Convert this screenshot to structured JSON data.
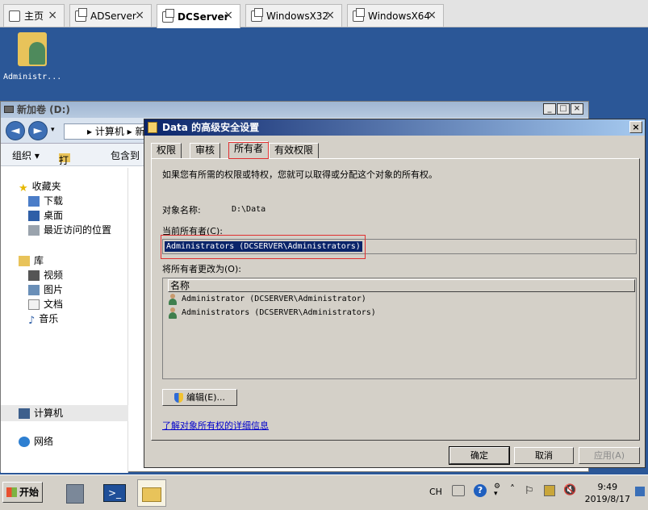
{
  "tabs": [
    {
      "label": "主页",
      "icon": "home-icon"
    },
    {
      "label": "ADServer",
      "icon": "window-icon"
    },
    {
      "label": "DCServer",
      "icon": "window-icon",
      "active": true
    },
    {
      "label": "WindowsX32",
      "icon": "window-icon"
    },
    {
      "label": "WindowsX64",
      "icon": "window-icon"
    }
  ],
  "desktop": {
    "icon_label": "Administr..."
  },
  "explorer": {
    "title": "新加卷 (D:)",
    "controls": {
      "minimize": "_",
      "maximize": "□",
      "close": "×"
    },
    "address": "▸ 计算机 ▸ 新",
    "toolbar": {
      "organize": "组织 ▾",
      "open": "打开",
      "include": "包含到"
    },
    "sidebar": {
      "favorites": "收藏夹",
      "downloads": "下载",
      "desktop": "桌面",
      "recent": "最近访问的位置",
      "libraries": "库",
      "videos": "视频",
      "pictures": "图片",
      "documents": "文档",
      "music": "音乐",
      "computer": "计算机",
      "network": "网络"
    }
  },
  "dialog": {
    "title": "Data 的高级安全设置",
    "close": "×",
    "tabs": [
      "权限",
      "审核",
      "所有者",
      "有效权限"
    ],
    "info": "如果您有所需的权限或特权，您就可以取得或分配这个对象的所有权。",
    "object_label": "对象名称:",
    "object_value": "D:\\Data",
    "current_owner_label": "当前所有者(C):",
    "current_owner_value": "Administrators (DCSERVER\\Administrators)",
    "change_label": "将所有者更改为(O):",
    "list_header": "名称",
    "list_items": [
      "Administrator (DCSERVER\\Administrator)",
      "Administrators (DCSERVER\\Administrators)"
    ],
    "edit_button": "编辑(E)...",
    "learn_link": "了解对象所有权的详细信息",
    "ok": "确定",
    "cancel": "取消",
    "apply": "应用(A)"
  },
  "taskbar": {
    "start": "开始",
    "lang": "CH",
    "time": "9:49",
    "date": "2019/8/17"
  }
}
